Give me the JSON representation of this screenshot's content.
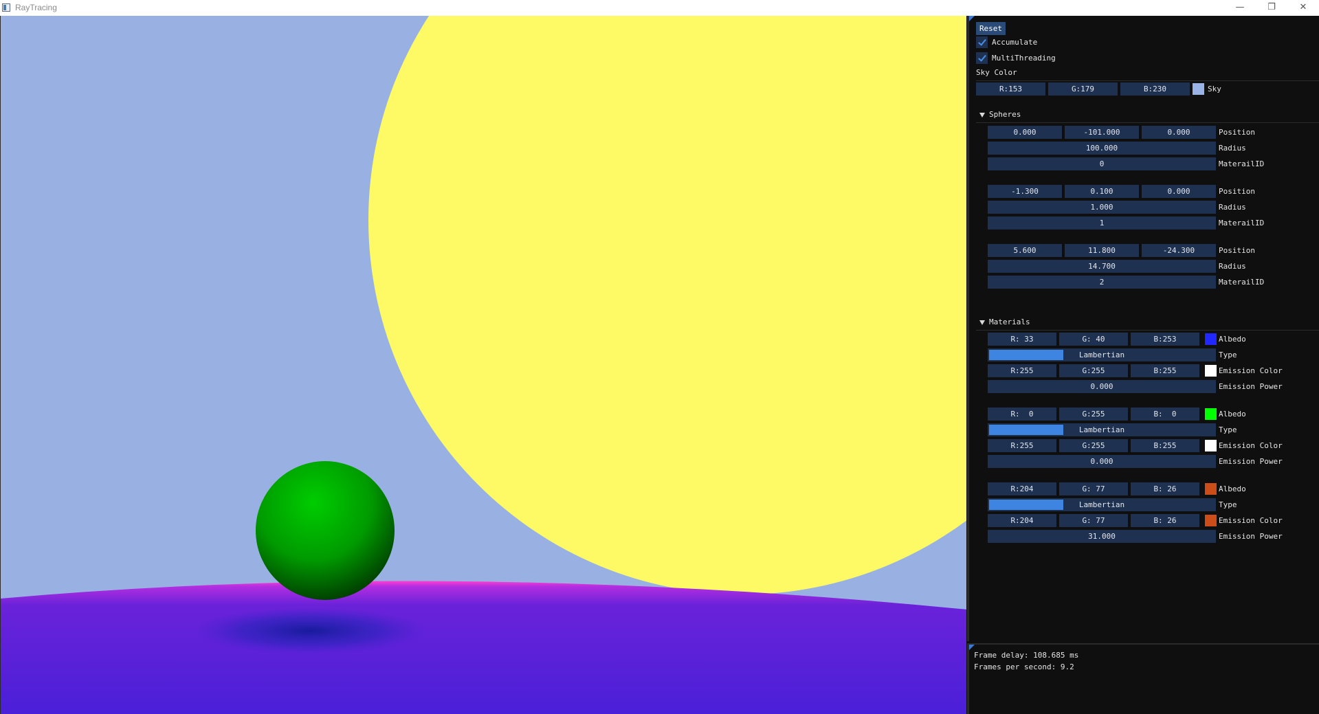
{
  "window": {
    "title": "RayTracing",
    "minimize_glyph": "—",
    "maximize_glyph": "❐",
    "close_glyph": "✕"
  },
  "scene_colors": {
    "sky": "#98b1e2",
    "yellow_sphere": "#fdfa66",
    "green_sphere": "#00b800",
    "ground": "#4a22d6",
    "ground_rim": "#ff3fc8"
  },
  "settings": {
    "reset_label": "Reset",
    "accumulate_label": "Accumulate",
    "accumulate_checked": true,
    "multithreading_label": "MultiThreading",
    "multithreading_checked": true,
    "sky_color_label": "Sky Color",
    "sky_r": "R:153",
    "sky_g": "G:179",
    "sky_b": "B:230",
    "sky_swatch": "#99b3e6",
    "sky_swatch_label": "Sky"
  },
  "spheres": {
    "header": "Spheres",
    "items": [
      {
        "position": [
          "0.000",
          "-101.000",
          "0.000"
        ],
        "position_label": "Position",
        "radius": "100.000",
        "radius_label": "Radius",
        "material_id": "0",
        "material_id_label": "MaterailID"
      },
      {
        "position": [
          "-1.300",
          "0.100",
          "0.000"
        ],
        "position_label": "Position",
        "radius": "1.000",
        "radius_label": "Radius",
        "material_id": "1",
        "material_id_label": "MaterailID"
      },
      {
        "position": [
          "5.600",
          "11.800",
          "-24.300"
        ],
        "position_label": "Position",
        "radius": "14.700",
        "radius_label": "Radius",
        "material_id": "2",
        "material_id_label": "MaterailID"
      }
    ]
  },
  "materials": {
    "header": "Materials",
    "items": [
      {
        "albedo": [
          "R: 33",
          "G: 40",
          "B:253"
        ],
        "albedo_swatch": "#2128fd",
        "albedo_label": "Albedo",
        "type": "Lambertian",
        "type_label": "Type",
        "emission": [
          "R:255",
          "G:255",
          "B:255"
        ],
        "emission_swatch": "#ffffff",
        "emission_label": "Emission Color",
        "power": "0.000",
        "power_label": "Emission Power"
      },
      {
        "albedo": [
          "R:  0",
          "G:255",
          "B:  0"
        ],
        "albedo_swatch": "#00ff00",
        "albedo_label": "Albedo",
        "type": "Lambertian",
        "type_label": "Type",
        "emission": [
          "R:255",
          "G:255",
          "B:255"
        ],
        "emission_swatch": "#ffffff",
        "emission_label": "Emission Color",
        "power": "0.000",
        "power_label": "Emission Power"
      },
      {
        "albedo": [
          "R:204",
          "G: 77",
          "B: 26"
        ],
        "albedo_swatch": "#cc4d1a",
        "albedo_label": "Albedo",
        "type": "Lambertian",
        "type_label": "Type",
        "emission": [
          "R:204",
          "G: 77",
          "B: 26"
        ],
        "emission_swatch": "#cc4d1a",
        "emission_label": "Emission Color",
        "power": "31.000",
        "power_label": "Emission Power"
      }
    ]
  },
  "stats": {
    "frame_delay": "Frame delay: 108.685 ms",
    "fps": "Frames per second: 9.2"
  }
}
